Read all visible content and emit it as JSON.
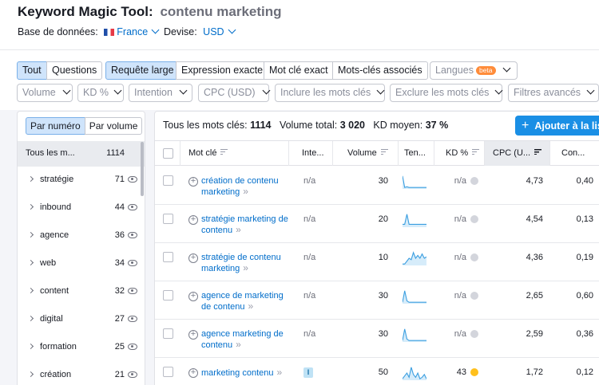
{
  "header": {
    "tool_title": "Keyword Magic Tool:",
    "query": "contenu marketing",
    "database_label": "Base de données:",
    "database_value": "France",
    "currency_label": "Devise:",
    "currency_value": "USD"
  },
  "filters": {
    "tabs1": [
      "Tout",
      "Questions"
    ],
    "tabs2": [
      "Requête large",
      "Expression exacte",
      "Mot clé exact",
      "Mots-clés associés"
    ],
    "languages": "Langues",
    "beta": "beta",
    "dropdowns": [
      "Volume",
      "KD %",
      "Intention",
      "CPC (USD)",
      "Inclure les mots clés",
      "Exclure les mots clés",
      "Filtres avancés"
    ]
  },
  "sidebar": {
    "toggle": [
      "Par numéro",
      "Par volume"
    ],
    "all_label": "Tous les m...",
    "all_count": "1114",
    "groups": [
      {
        "label": "stratégie",
        "count": "71"
      },
      {
        "label": "inbound",
        "count": "44"
      },
      {
        "label": "agence",
        "count": "36"
      },
      {
        "label": "web",
        "count": "34"
      },
      {
        "label": "content",
        "count": "32"
      },
      {
        "label": "digital",
        "count": "27"
      },
      {
        "label": "formation",
        "count": "25"
      },
      {
        "label": "création",
        "count": "21"
      }
    ]
  },
  "summary": {
    "all_keywords_label": "Tous les mots clés:",
    "all_keywords_value": "1114",
    "total_volume_label": "Volume total:",
    "total_volume_value": "3 020",
    "avg_kd_label": "KD moyen:",
    "avg_kd_value": "37 %",
    "add_button": "Ajouter à la liste"
  },
  "table": {
    "columns": [
      "Mot clé",
      "Inte...",
      "Volume",
      "Ten...",
      "KD %",
      "CPC (U...",
      "Con..."
    ],
    "rows": [
      {
        "keyword": "création de contenu marketing",
        "intent": "n/a",
        "volume": "30",
        "kd": "n/a",
        "cpc": "4,73",
        "com": "0,40",
        "trend": [
          0.1,
          0.9,
          0.85,
          0.9,
          0.9,
          0.9,
          0.9,
          0.9,
          0.9,
          0.9,
          0.9,
          0.9
        ]
      },
      {
        "keyword": "stratégie marketing de contenu",
        "intent": "n/a",
        "volume": "20",
        "kd": "n/a",
        "cpc": "4,54",
        "com": "0,13",
        "trend": [
          0.8,
          0.8,
          0.1,
          0.8,
          0.8,
          0.8,
          0.8,
          0.8,
          0.8,
          0.8,
          0.8,
          0.8
        ]
      },
      {
        "keyword": "stratégie de contenu marketing",
        "intent": "n/a",
        "volume": "10",
        "kd": "n/a",
        "cpc": "4,36",
        "com": "0,19",
        "trend": [
          0.9,
          0.9,
          0.7,
          0.5,
          0.6,
          0.1,
          0.5,
          0.3,
          0.5,
          0.2,
          0.5,
          0.4
        ]
      },
      {
        "keyword": "agence de marketing de contenu",
        "intent": "n/a",
        "volume": "30",
        "kd": "n/a",
        "cpc": "2,65",
        "com": "0,60",
        "trend": [
          0.9,
          0.1,
          0.8,
          0.9,
          0.9,
          0.9,
          0.9,
          0.9,
          0.9,
          0.9,
          0.9,
          0.9
        ]
      },
      {
        "keyword": "agence marketing de contenu",
        "intent": "n/a",
        "volume": "30",
        "kd": "n/a",
        "cpc": "2,59",
        "com": "0,36",
        "trend": [
          0.9,
          0.1,
          0.8,
          0.9,
          0.9,
          0.9,
          0.9,
          0.9,
          0.9,
          0.9,
          0.9,
          0.9
        ]
      },
      {
        "keyword": "marketing contenu",
        "intent": "I",
        "volume": "50",
        "kd": "43",
        "cpc": "1,72",
        "com": "0,12",
        "trend": [
          0.9,
          0.7,
          0.5,
          0.8,
          0.1,
          0.6,
          0.8,
          0.5,
          0.9,
          0.8,
          0.6,
          0.9
        ]
      }
    ]
  },
  "colors": {
    "accent": "#1a8fe5",
    "link": "#006dca",
    "kd_yellow": "#ffc01d"
  }
}
